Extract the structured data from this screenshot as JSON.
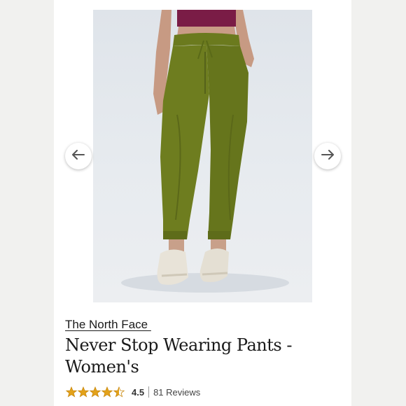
{
  "product": {
    "brand": "The North Face ",
    "title": "Never Stop Wearing Pants - Women's",
    "rating": "4.5",
    "reviews": "81 Reviews",
    "rating_stars": 4.5,
    "star_color": "#e3a21a"
  },
  "icons": {
    "prev": "arrow-left-icon",
    "next": "arrow-right-icon"
  }
}
